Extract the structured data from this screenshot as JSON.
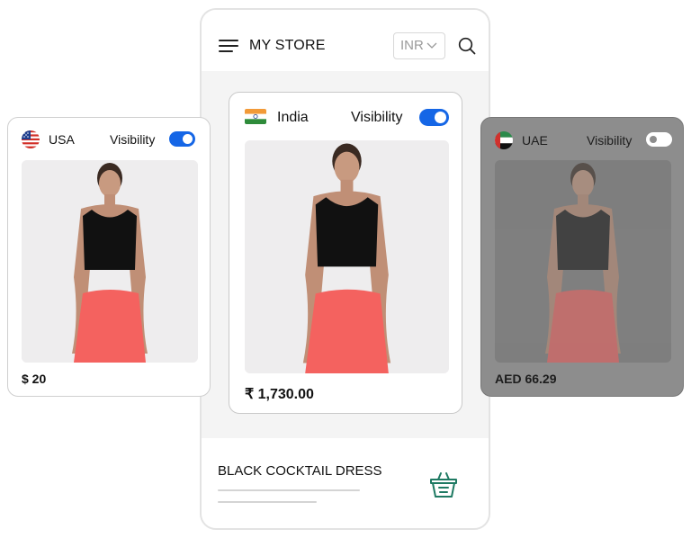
{
  "store": {
    "title": "MY STORE",
    "currency": "INR"
  },
  "product": {
    "name": "BLACK COCKTAIL DRESS"
  },
  "cards": {
    "usa": {
      "country": "USA",
      "visibility_label": "Visibility",
      "visible": true,
      "price": "$ 20"
    },
    "india": {
      "country": "India",
      "visibility_label": "Visibility",
      "visible": true,
      "price": "₹ 1,730.00"
    },
    "uae": {
      "country": "UAE",
      "visibility_label": "Visibility",
      "visible": false,
      "price": "AED 66.29"
    }
  },
  "colors": {
    "accent": "#1566e6",
    "basket": "#1f7a63",
    "disabled_overlay": "#8d8d8d"
  },
  "icons": {
    "menu": "hamburger-icon",
    "search": "search-icon",
    "dropdown": "chevron-down-icon",
    "cart": "basket-icon"
  }
}
